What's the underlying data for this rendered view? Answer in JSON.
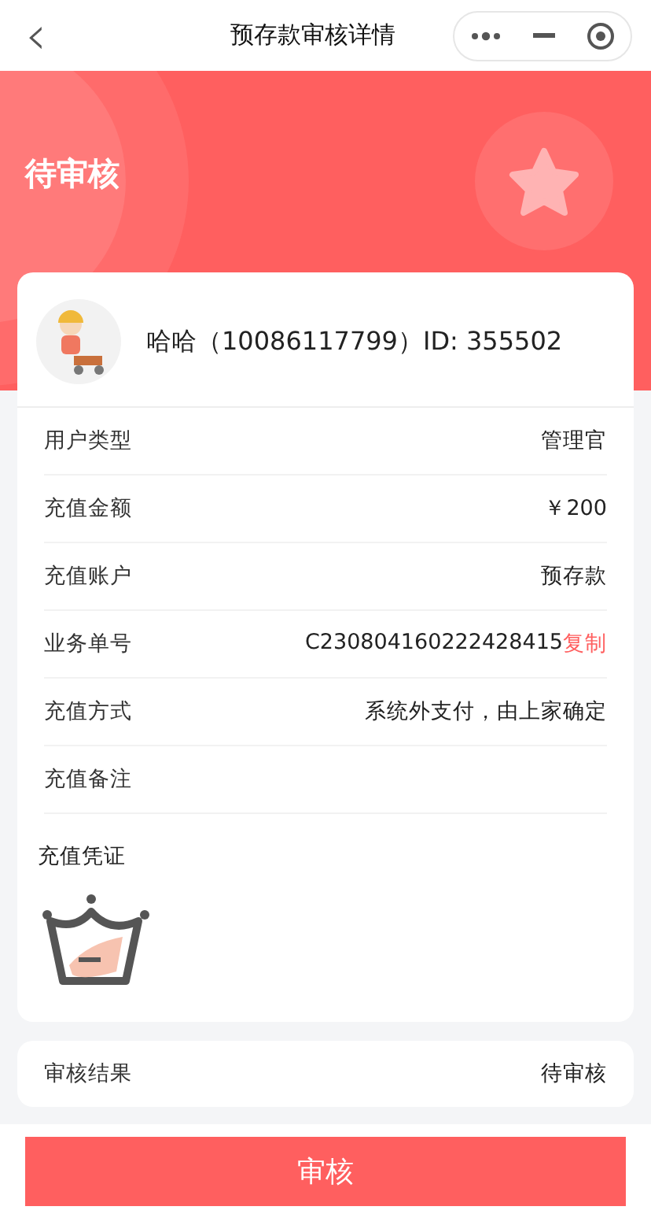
{
  "nav": {
    "back": "‹",
    "title": "预存款审核详情"
  },
  "header": {
    "status": "待审核"
  },
  "user": {
    "name": "哈哈（10086117799）ID: 355502"
  },
  "fields": [
    {
      "kind": "text",
      "label": "用户类型",
      "value": "管理官"
    },
    {
      "kind": "text",
      "label": "充值金额",
      "value": "￥200"
    },
    {
      "kind": "text",
      "label": "充值账户",
      "value": "预存款"
    },
    {
      "kind": "copy",
      "label": "业务单号",
      "value": "C230804160222428415",
      "action": "复制"
    },
    {
      "kind": "text",
      "label": "充值方式",
      "value": "系统外支付，由上家确定"
    },
    {
      "kind": "text",
      "label": "充值备注"
    }
  ],
  "voucher": {
    "label": "充值凭证"
  },
  "review": {
    "label": "审核结果",
    "value": "待审核"
  },
  "action_button": "审核"
}
